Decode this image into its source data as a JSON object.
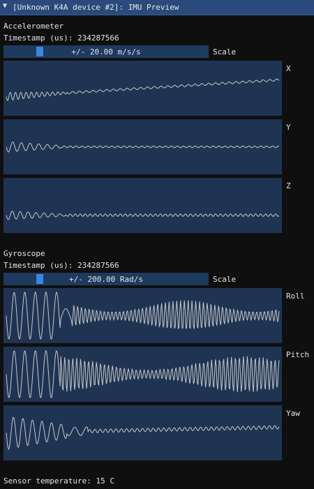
{
  "window": {
    "title": "[Unknown K4A device #2]: IMU Preview",
    "collapse_glyph": "▼"
  },
  "accelerometer": {
    "header": "Accelerometer",
    "timestamp_label": "Timestamp (us): 234287566",
    "scale_value": "+/- 20.00 m/s/s",
    "scale_slider_fraction": 0.2,
    "scale_label": "Scale",
    "plots": [
      {
        "axis": "X"
      },
      {
        "axis": "Y"
      },
      {
        "axis": "Z"
      }
    ]
  },
  "gyroscope": {
    "header": "Gyroscope",
    "timestamp_label": "Timestamp (us): 234287566",
    "scale_value": "+/- 200.00 Rad/s",
    "scale_slider_fraction": 0.2,
    "scale_label": "Scale",
    "plots": [
      {
        "axis": "Roll"
      },
      {
        "axis": "Pitch"
      },
      {
        "axis": "Yaw"
      }
    ]
  },
  "footer": {
    "sensor_temperature": "Sensor temperature: 15 C"
  },
  "colors": {
    "titlebar": "#294a7a",
    "plot_bg": "#1f3453",
    "slider_bg": "#1f3a5f",
    "slider_knob": "#3d85e0",
    "trace": "#c8c8c8"
  }
}
